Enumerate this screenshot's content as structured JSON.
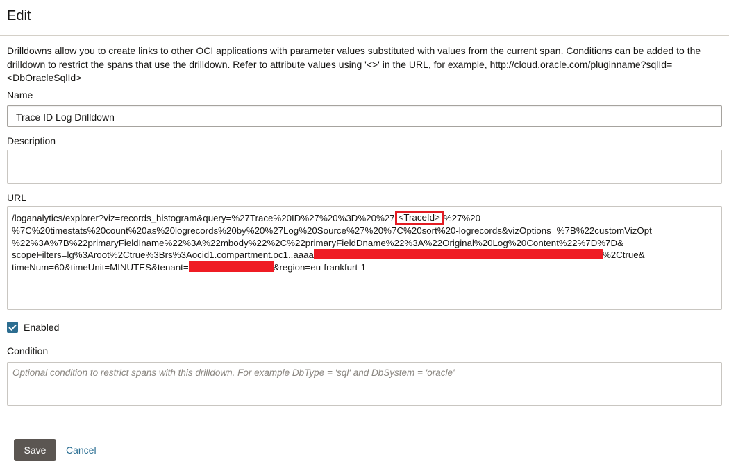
{
  "dialog": {
    "title": "Edit"
  },
  "intro_text": "Drilldowns allow you to create links to other OCI applications with parameter values substituted with values from the current span. Conditions can be added to the drilldown to restrict the spans that use the drilldown. Refer to attribute values using '<>' in the URL, for example, http://cloud.oracle.com/pluginname?sqlId=<DbOracleSqlId>",
  "name": {
    "label": "Name",
    "value": "Trace ID Log Drilldown"
  },
  "description": {
    "label": "Description",
    "value": ""
  },
  "url": {
    "label": "URL",
    "line1_pre": "/loganalytics/explorer?viz=records_histogram&query=%27Trace%20ID%27%20%3D%20%27",
    "line1_token": "<TraceId>",
    "line1_post": "%27%20",
    "line2": "%7C%20timestats%20count%20as%20logrecords%20by%20%27Log%20Source%27%20%7C%20sort%20-logrecords&vizOptions=%7B%22customVizOpt",
    "line3": "%22%3A%7B%22primaryFieldIname%22%3A%22mbody%22%2C%22primaryFieldDname%22%3A%22Original%20Log%20Content%22%7D%7D&",
    "line4_pre": "scopeFilters=lg%3Aroot%2Ctrue%3Brs%3Aocid1.compartment.oc1..aaaa",
    "line4_post": "%2Ctrue&",
    "line5_pre": "timeNum=60&timeUnit=MINUTES&tenant=",
    "line5_post": "&region=eu-frankfurt-1"
  },
  "enabled": {
    "label": "Enabled",
    "checked": true
  },
  "condition": {
    "label": "Condition",
    "placeholder": "Optional condition to restrict spans with this drilldown. For example DbType = 'sql' and DbSystem = 'oracle'"
  },
  "buttons": {
    "save": "Save",
    "cancel": "Cancel"
  },
  "colors": {
    "accent": "#2c6d90",
    "redaction": "#ef1c24",
    "highlight_border": "#e31c23",
    "save_button": "#5b5652"
  }
}
